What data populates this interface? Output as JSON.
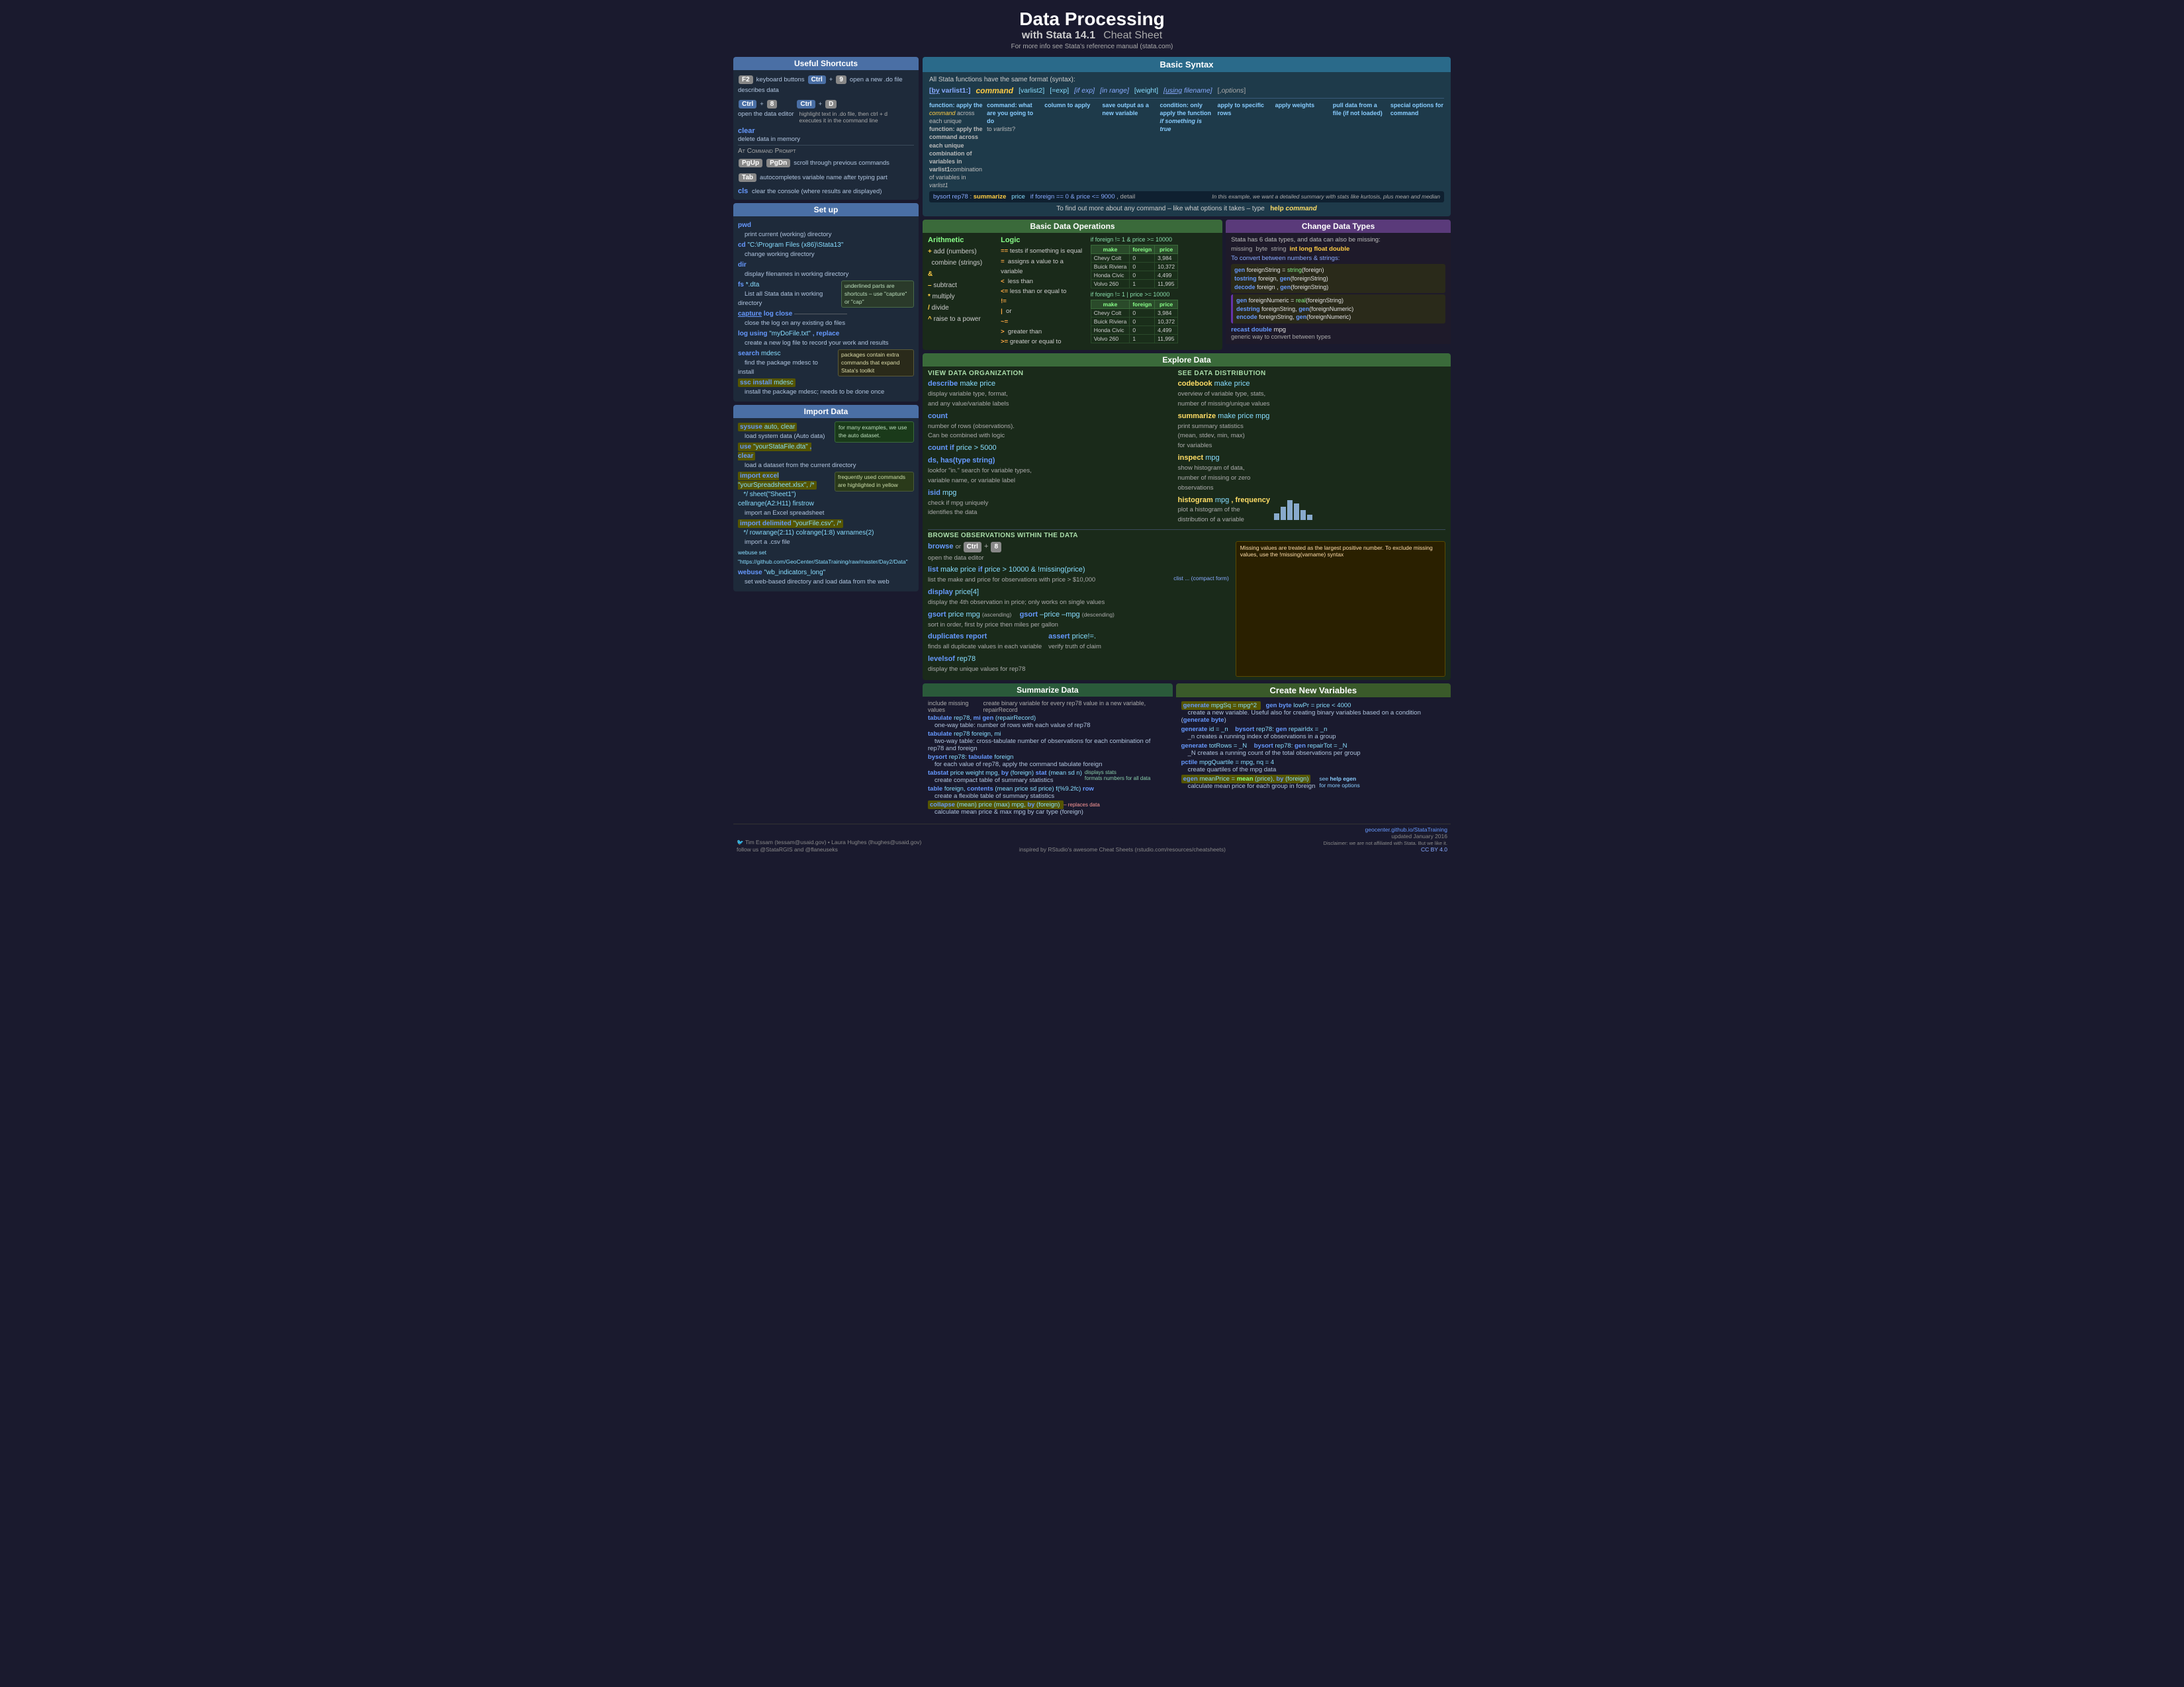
{
  "page": {
    "title": "Data Processing",
    "subtitle": "with Stata 14.1",
    "cheatsheet": "Cheat Sheet",
    "more_info": "For more info see Stata's reference manual (stata.com)"
  },
  "shortcuts": {
    "header": "Useful Shortcuts",
    "items": [
      {
        "key": "F2",
        "desc": "keyboard buttons",
        "key2": "Ctrl",
        "key2b": "9",
        "desc2": "open a new .do file"
      },
      {
        "desc_full": "describes data"
      },
      {
        "key": "Ctrl",
        "keyb": "8",
        "key2": "Ctrl",
        "key2b": "D",
        "desc": "open the data editor",
        "desc2": "highlight text in .do file, then ctrl + d executes it in the command line"
      },
      {
        "key": "clear",
        "desc": "delete data in memory"
      }
    ],
    "at_cmd": "At Command Prompt",
    "pgup_pgdn": "scroll through previous commands",
    "tab_desc": "autocompletes variable name after typing part",
    "cls_desc": "clear the console (where results are displayed)"
  },
  "setup": {
    "header": "Set up",
    "pwd_desc": "print current (working) directory",
    "cd_cmd": "cd \"C:\\Program Files (x86)\\Stata13\"",
    "cd_desc": "change working directory",
    "dir_desc": "display filenames in working directory",
    "fs_cmd": "fs *.dta",
    "fs_desc": "List all Stata data in working directory",
    "fs_note": "underlined parts are shortcuts – use 'capture' or 'cap'",
    "caplog_cmd": "capture log close",
    "caplog_desc": "close the log on any existing do files",
    "log_cmd": "log using \"myDoFile.txt\", replace",
    "log_desc": "create a new log file to record your work and results",
    "search_cmd": "search mdesc",
    "search_desc": "find the package mdesc to install",
    "ssc_cmd": "ssc install mdesc",
    "ssc_desc": "install the package mdesc; needs to be done once",
    "pkg_note": "packages contain extra commands that expand Stata's toolkit"
  },
  "import": {
    "header": "Import Data",
    "sysuse_cmd": "sysuse auto, clear",
    "sysuse_desc": "load system data (Auto data)",
    "use_cmd": "use \"yourStataFile.dta\", clear",
    "use_desc": "load a dataset from the current directory",
    "import_excel_cmd": "import excel \"yourSpreadsheet.xlsx\", /*",
    "import_excel_cmd2": "*/ sheet(\"Sheet1\") cellrange(A2:H11) firstrow",
    "import_excel_desc": "import an Excel spreadsheet",
    "import_delim_cmd": "import delimited \"yourFile.csv\", /*",
    "import_delim_cmd2": "*/ rowrange(2:11) colrange(1:8) varnames(2)",
    "import_delim_desc": "import a .csv file",
    "webuse_cmd": "webuse set \"https://github.com/GeoCenter/StataTraining/raw/master/Day2/Data\"",
    "webuse2_cmd": "webuse \"wb_indicators_long\"",
    "webuse2_desc": "set web-based directory and load data from the web",
    "note_many": "for many examples, we use the auto dataset.",
    "note_frequent": "frequently used commands are highlighted in yellow"
  },
  "basic_syntax": {
    "header": "Basic Syntax",
    "intro": "All Stata functions have the same format (syntax):",
    "parts": [
      {
        "label": "[by varlist1:]",
        "type": "bracket"
      },
      {
        "label": "command",
        "type": "command"
      },
      {
        "label": "[varlist2]",
        "type": "bracket"
      },
      {
        "label": "[=exp]",
        "type": "bracket"
      },
      {
        "label": "[if exp]",
        "type": "bracket"
      },
      {
        "label": "[in range]",
        "type": "bracket"
      },
      {
        "label": "[weight]",
        "type": "bracket"
      },
      {
        "label": "[using filename]",
        "type": "bracket"
      },
      {
        "label": "[,options]",
        "type": "bracket"
      }
    ],
    "col_by": {
      "label": "function: apply the command across each unique combination of variables in varlist1"
    },
    "col_cmd": {
      "label": "command: what are you going to do to varlists?"
    },
    "col_var": {
      "label": "column to apply"
    },
    "col_exp": {
      "label": "save output as a new variable"
    },
    "col_if": {
      "label": "condition: only apply the function if something is true"
    },
    "col_in": {
      "label": "apply to specific rows"
    },
    "col_weight": {
      "label": "apply weights"
    },
    "col_using": {
      "label": "pull data from a file (if not loaded)"
    },
    "col_options": {
      "label": "special options for command"
    },
    "example": "bysort rep78 :  summarize   price   if foreign == 0 & price <= 9000, detail",
    "note": "In this example, we want a detailed summary with stats like kurtosis, plus mean and median",
    "help_text": "To find out more about any command – like what options it takes – type",
    "help_cmd": "help command"
  },
  "data_ops": {
    "header": "Basic Data Operations",
    "arithmetic": {
      "title": "Arithmetic",
      "items": [
        {
          "op": "+",
          "desc": "add (numbers) combine (strings)"
        },
        {
          "op": "&",
          "desc": ""
        },
        {
          "op": "-",
          "desc": "subtract"
        },
        {
          "op": "*",
          "desc": "multiply"
        },
        {
          "op": "/",
          "desc": "divide"
        },
        {
          "op": "^",
          "desc": "raise to a power"
        }
      ]
    },
    "logic": {
      "title": "Logic",
      "items": [
        {
          "op": "==",
          "desc": "tests if something is equal"
        },
        {
          "op": "=",
          "desc": "assigns a value to a variable"
        },
        {
          "op": "<",
          "desc": "less than"
        },
        {
          "op": "<=",
          "desc": "less than or equal to"
        },
        {
          "op": "!=",
          "desc": ""
        },
        {
          "op": "|",
          "desc": "or"
        },
        {
          "op": "~=",
          "desc": ""
        },
        {
          "op": ">",
          "desc": "greater than"
        },
        {
          "op": ">=",
          "desc": "greater or equal to"
        }
      ]
    },
    "example1_cond": "if foreign != 1 & price >= 10000",
    "example2_cond": "if foreign != 1 | price >= 10000",
    "table1_rows": [
      {
        "make": "Chev. Colt",
        "price": "0",
        "val": "3,984"
      },
      {
        "make": "Buick Riviera",
        "price": "0",
        "val": "10,372"
      },
      {
        "make": "Honda Civic",
        "price": "0",
        "val": "4,499"
      },
      {
        "make": "Volvo 260",
        "price": "1",
        "val": "11,995"
      }
    ],
    "table2_rows": [
      {
        "make": "Chev. Colt",
        "price": "0",
        "val": "3,984"
      },
      {
        "make": "Buick Riviera",
        "price": "0",
        "val": "10,372"
      },
      {
        "make": "Honda Civic",
        "price": "0",
        "val": "4,499"
      },
      {
        "make": "Volvo 260",
        "price": "1",
        "val": "11,995"
      }
    ]
  },
  "explore": {
    "header": "Explore Data",
    "view_org": {
      "title": "View Data Organization",
      "items": [
        {
          "cmd": "describe",
          "args": "make price",
          "desc": "display variable type, format, and any value/variable labels"
        },
        {
          "cmd": "count",
          "args": "",
          "desc": "number of rows (observations). Can be combined with logic"
        },
        {
          "cmd": "count if",
          "args": "price > 5000",
          "desc": ""
        },
        {
          "cmd": "ds, has(type string)",
          "args": "",
          "desc": "lookfor \"in.\" search for variable types, variable name, or variable label"
        },
        {
          "cmd": "isid",
          "args": "mpg",
          "desc": "check if mpg uniquely identifies the data"
        }
      ]
    },
    "see_dist": {
      "title": "See Data Distribution",
      "items": [
        {
          "cmd": "codebook",
          "args": "make price",
          "desc": "overview of variable type, stats, number of missing/unique values"
        },
        {
          "cmd": "summarize",
          "args": "make price mpg",
          "desc": "print summary statistics (mean, stdev, min, max) for variables"
        },
        {
          "cmd": "inspect",
          "args": "mpg",
          "desc": "show histogram of data, number of missing or zero observations"
        },
        {
          "cmd": "histogram",
          "args": "mpg, frequency",
          "desc": "plot a histogram of the distribution of a variable"
        }
      ]
    },
    "browse_title": "Browse Observations within the Data",
    "browse_note": "Missing values are treated as the largest positive number. To exclude missing values, use the !missing(varname) syntax",
    "browse_items": [
      {
        "cmd": "browse",
        "alt": "or Ctrl + 8",
        "desc": "open the data editor"
      },
      {
        "cmd": "list",
        "args": "make price if price > 10000 & !missing(price)",
        "desc": "list the make and price for observations with price > $10,000",
        "note": "clist ... (compact form)"
      },
      {
        "cmd": "display",
        "args": "price[4]",
        "desc": "display the 4th observation in price; only works on single values"
      },
      {
        "cmd": "gsort",
        "args": "price mpg",
        "note": "(ascending)",
        "cmd2": "gsort –price –mpg",
        "note2": "(descending)",
        "desc": "sort in order, first by price then miles per gallon"
      },
      {
        "cmd": "duplicates report",
        "desc": "finds all duplicate values in each variable",
        "cmd2": "assert price!=.",
        "desc2": "verify truth of claim"
      },
      {
        "cmd": "levelsof",
        "args": "rep78",
        "desc": "display the unique values for rep78"
      }
    ]
  },
  "change_types": {
    "header": "Change Data Types",
    "intro": "Stata has 6 data types, and data can also be missing:",
    "types": [
      "missing",
      "byte",
      "string",
      "int",
      "long",
      "float",
      "double"
    ],
    "convert_title": "To convert between numbers & strings:",
    "convert_items": [
      "gen foreignString = string(foreign)",
      "tostring foreign, gen(foreignString)",
      "decode foreign, gen(foreignString)",
      "gen foreignNumeric = real(foreignString)",
      "destring foreignString, gen(foreignNumeric)",
      "encode foreignString, gen(foreignNumeric)",
      "recast double mpg",
      "generic way to convert between types"
    ]
  },
  "summarize": {
    "header": "Summarize Data",
    "items": [
      {
        "note": "include missing values",
        "note2": "create binary variable for every rep78 value in a new variable, repairRecord",
        "cmd": "tabulate rep78, mi gen(repairRecord)",
        "desc": "one-way table: number of rows with each value of rep78"
      },
      {
        "cmd": "tabulate rep78 foreign, mi",
        "desc": "two-way table: cross-tabulate number of observations for each combination of rep78 and foreign"
      },
      {
        "cmd": "bysort rep78: tabulate foreign",
        "desc": "for each value of rep78, apply the command tabulate foreign"
      },
      {
        "cmd": "tabstat price weight mpg, by(foreign) stat(mean sd n)",
        "desc": "create compact table of summary statistics",
        "note": "displays stats formats numbers for all data"
      },
      {
        "cmd": "table foreign, contents(mean price sd price) f(%9.2fc) row",
        "desc": "create a flexible table of summary statistics"
      },
      {
        "cmd": "collapse (mean) price (max) mpg, by(foreign)",
        "desc": "calculate mean price & max mpg by car type (foreign)",
        "note": "replaces data"
      }
    ]
  },
  "create_vars": {
    "header": "Create New Variables",
    "items": [
      {
        "cmd": "generate mpgSq = mpg^2",
        "note": "gen byte lowPr = price < 4000",
        "desc": "create a new variable. Useful also for creating binary variables based on a condition (generate byte)"
      },
      {
        "cmd": "generate id = _n",
        "note": "bysort rep78: gen repairIdx = _n",
        "desc": "_n creates a running index of observations in a group"
      },
      {
        "cmd": "generate totRows = _N",
        "note": "bysort rep78: gen repairTot = _N",
        "desc": "_N creates a running count of the total observations per group"
      },
      {
        "cmd": "pctile mpgQuartile = mpg, nq = 4",
        "desc": "create quartiles of the mpg data"
      },
      {
        "cmd": "egen meanPrice = mean(price), by(foreign)",
        "desc": "calculate mean price for each group in foreign",
        "note": "see help egen for more options"
      }
    ]
  },
  "footer": {
    "authors": "Tim Essam (tessam@usaid.gov) • Laura Hughes (lhughes@usaid.gov)",
    "inspired": "inspired by RStudio's awesome Cheat Sheets (rstudio.com/resources/cheatsheets)",
    "org": "geocenter.github.io/StataTraining",
    "updated": "updated January 2016",
    "disclaimer": "Disclaimer: we are not affiliated with Stata. But we like it.",
    "twitter": "follow us @StataRGIS and @flaneuseks",
    "license": "CC BY 4.0"
  }
}
